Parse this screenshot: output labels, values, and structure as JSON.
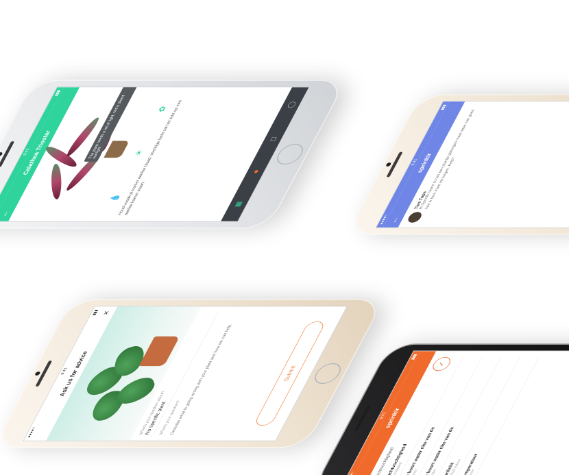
{
  "phone1": {
    "title": "Calathea Triostar",
    "tooltip": "The plant needs a lot of light, not in direct sunlight",
    "description": "Houd vaaak je kamer aardse blaad. Vochtige lucht zal het licht op een aardse kamer staan.",
    "colors": {
      "accent": "#2fd39c",
      "tabbar": "#3b4046"
    },
    "icons": [
      "water-drop-icon",
      "sun-icon",
      "flower-icon"
    ]
  },
  "phone2": {
    "title": "sprinklr",
    "sender": "Ties Tops",
    "message": "Hi Sprinklr team! Ik heb een plantje gekregen maar weet niet goed hoe ik hem moet verzorgen. Help?",
    "colors": {
      "accent": "#6f86e6"
    }
  },
  "phone3": {
    "title": "Ask us for advice",
    "label1": "What's your question about?",
    "value1": "No specific plant",
    "label2": "What's your question?",
    "note": "Describe what is going wrong with your plant and how we can help.",
    "submit": "Submit",
    "colors": {
      "accent": "#f28a4b"
    }
  },
  "phone4": {
    "title": "sprinklr",
    "section": "Luchtvochtigheid",
    "questions": [
      {
        "q": "Luchtvochtigheid",
        "a": "Gemiddeld"
      },
      {
        "q": "Je hoort water rike van de",
        "a": "Zomer"
      },
      {
        "q": "Je hoort water rike van de",
        "a": "Winter"
      },
      {
        "q": "Zonlicht",
        "a": "Halfschaduw"
      },
      {
        "q": "Temperatuur",
        "a": "Kamer"
      }
    ],
    "colors": {
      "accent": "#f06a2b"
    }
  }
}
